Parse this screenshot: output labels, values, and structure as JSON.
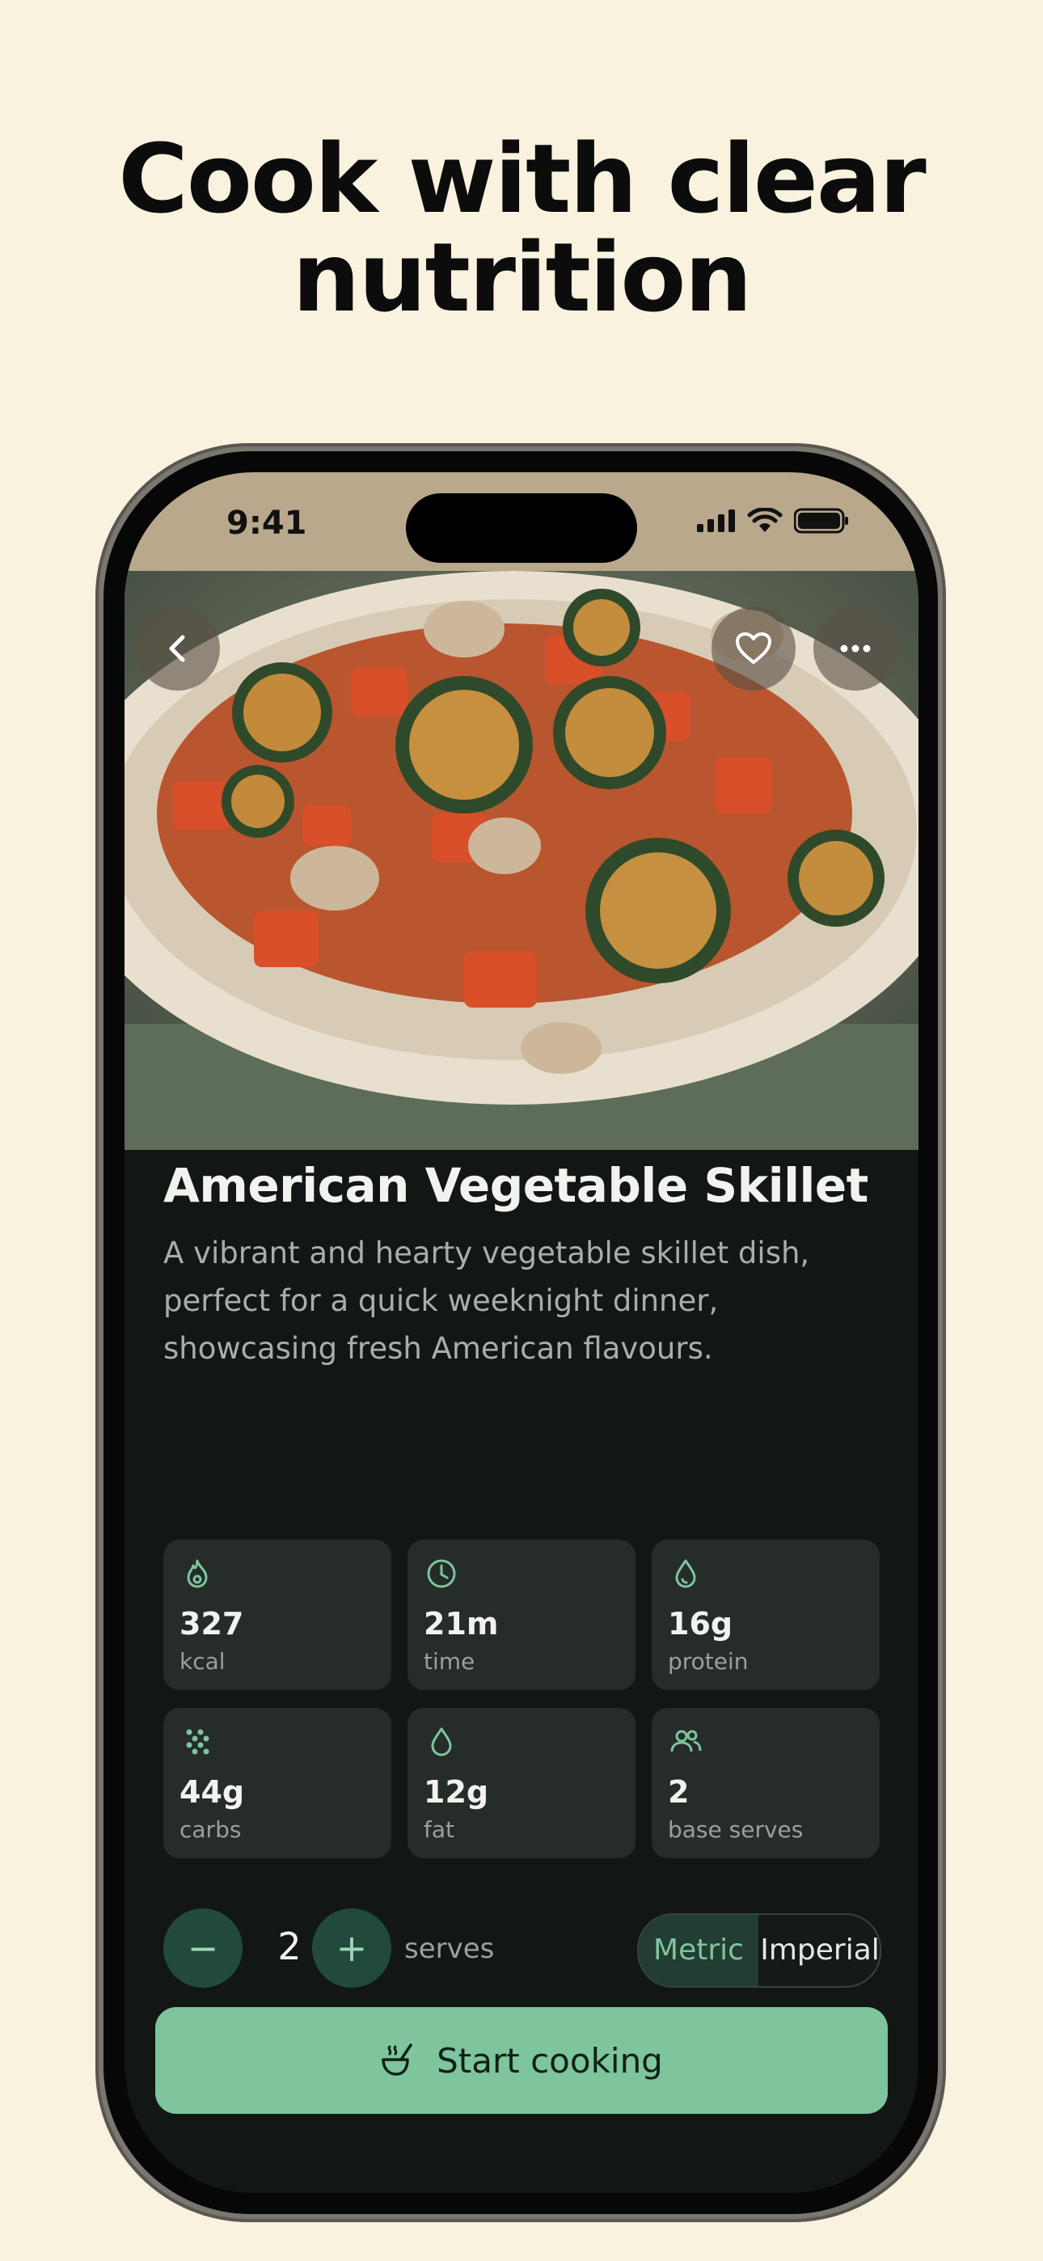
{
  "marketing": {
    "headline_line1": "Cook with clear",
    "headline_line2": "nutrition"
  },
  "status_bar": {
    "time": "9:41",
    "icons": [
      "signal-icon",
      "wifi-icon",
      "battery-icon"
    ]
  },
  "hero": {
    "image": "vegetable-skillet-photo",
    "buttons": [
      "back-icon",
      "heart-icon",
      "more-icon"
    ]
  },
  "recipe": {
    "title": "American Vegetable Skillet",
    "description": "A vibrant and hearty vegetable skillet dish, perfect for a quick weeknight dinner, showcasing fresh American flavours."
  },
  "stats": [
    {
      "icon": "flame-icon",
      "value": "327",
      "label": "kcal"
    },
    {
      "icon": "clock-icon",
      "value": "21m",
      "label": "time"
    },
    {
      "icon": "protein-drop-icon",
      "value": "16g",
      "label": "protein"
    },
    {
      "icon": "carbs-dots-icon",
      "value": "44g",
      "label": "carbs"
    },
    {
      "icon": "fat-drop-icon",
      "value": "12g",
      "label": "fat"
    },
    {
      "icon": "people-icon",
      "value": "2",
      "label": "base serves"
    }
  ],
  "servings": {
    "minus": "−",
    "plus": "+",
    "count": "2",
    "label": "serves"
  },
  "units": {
    "metric": "Metric",
    "imperial": "Imperial",
    "selected": "Metric"
  },
  "cta": {
    "label": "Start cooking",
    "icon": "cooking-icon"
  },
  "colors": {
    "background": "#f8f2df",
    "accent": "#7ec49c",
    "surface": "#121715",
    "card": "#252c29"
  }
}
